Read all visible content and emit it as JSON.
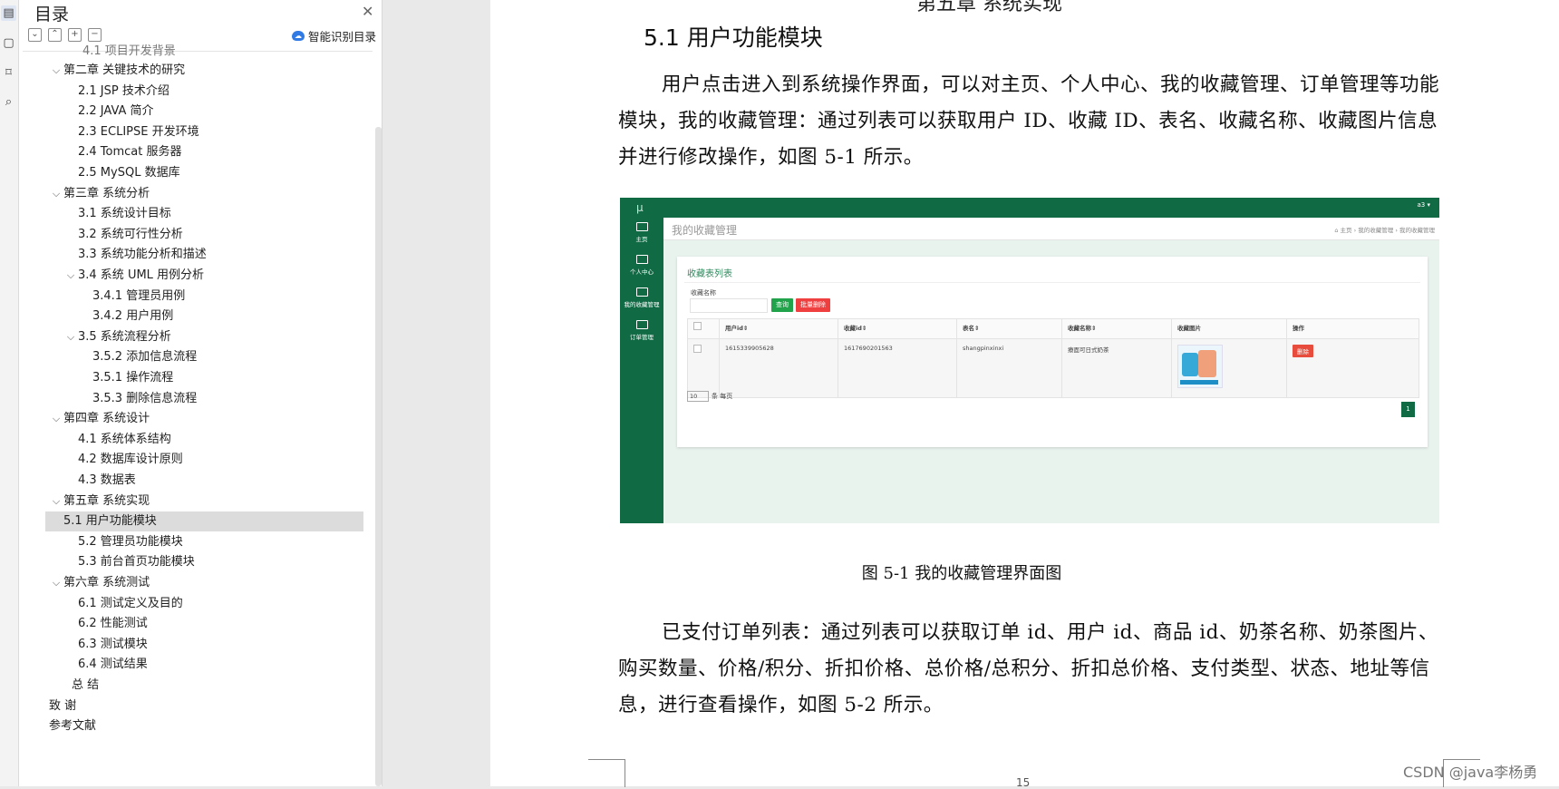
{
  "toc": {
    "title": "目录",
    "smart_label": "智能识别目录",
    "partial_top": "4.1 项目开发背景",
    "items": [
      {
        "label": "第二章 关键技术的研究",
        "level": 0,
        "chev": "⌄"
      },
      {
        "label": "2.1 JSP 技术介绍",
        "level": 1
      },
      {
        "label": "2.2 JAVA 简介",
        "level": 1
      },
      {
        "label": "2.3 ECLIPSE 开发环境",
        "level": 1
      },
      {
        "label": "2.4 Tomcat 服务器",
        "level": 1
      },
      {
        "label": "2.5 MySQL 数据库",
        "level": 1
      },
      {
        "label": "第三章  系统分析",
        "level": 0,
        "chev": "⌄"
      },
      {
        "label": "3.1  系统设计目标",
        "level": 1
      },
      {
        "label": "3.2  系统可行性分析",
        "level": 1
      },
      {
        "label": "3.3  系统功能分析和描述",
        "level": 1
      },
      {
        "label": "3.4 系统 UML 用例分析",
        "level": 1,
        "chev": "⌄"
      },
      {
        "label": "3.4.1 管理员用例",
        "level": 2
      },
      {
        "label": "3.4.2 用户用例",
        "level": 2
      },
      {
        "label": "3.5 系统流程分析",
        "level": 1,
        "chev": "⌄"
      },
      {
        "label": "3.5.2 添加信息流程",
        "level": 2
      },
      {
        "label": "3.5.1 操作流程",
        "level": 2
      },
      {
        "label": "3.5.3 删除信息流程",
        "level": 2
      },
      {
        "label": "第四章  系统设计",
        "level": 0,
        "chev": "⌄"
      },
      {
        "label": "4.1  系统体系结构",
        "level": 1
      },
      {
        "label": "4.2  数据库设计原则",
        "level": 1
      },
      {
        "label": "4.3  数据表",
        "level": 1
      },
      {
        "label": "第五章  系统实现",
        "level": 0,
        "chev": "⌄"
      },
      {
        "label": "5.1 用户功能模块",
        "level": 1,
        "selected": true
      },
      {
        "label": "5.2 管理员功能模块",
        "level": 1
      },
      {
        "label": "5.3 前台首页功能模块",
        "level": 1
      },
      {
        "label": "第六章    系统测试",
        "level": 0,
        "chev": "⌄"
      },
      {
        "label": "6.1 测试定义及目的",
        "level": 1
      },
      {
        "label": "6.2 性能测试",
        "level": 1
      },
      {
        "label": "6.3 测试模块",
        "level": 1
      },
      {
        "label": "6.4 测试结果",
        "level": 1
      },
      {
        "label": "总    结",
        "level": 0.6
      },
      {
        "label": "致    谢",
        "level": 0
      },
      {
        "label": "参考文献",
        "level": 0
      }
    ]
  },
  "doc": {
    "top_partial": "第五章   系统实现",
    "section_title": "5.1 用户功能模块",
    "para1": "用户点击进入到系统操作界面，可以对主页、个人中心、我的收藏管理、订单管理等功能模块，我的收藏管理：通过列表可以获取用户 ID、收藏 ID、表名、收藏名称、收藏图片信息并进行修改操作，如图 5-1 所示。",
    "caption": "图 5-1 我的收藏管理界面图",
    "para2": "已支付订单列表：通过列表可以获取订单 id、用户 id、商品 id、奶茶名称、奶茶图片、购买数量、价格/积分、折扣价格、总价格/总积分、折扣总价格、支付类型、状态、地址等信息，进行查看操作，如图 5-2 所示。",
    "page_num": "15",
    "watermark": "CSDN @java李杨勇"
  },
  "figure": {
    "logo": "µ",
    "user": "a3 ▾",
    "nav": [
      "主页",
      "个人中心",
      "我的收藏管理",
      "订单管理"
    ],
    "header_title": "我的收藏管理",
    "breadcrumb": "⌂ 主页  ›  我的收藏管理  ›  我的收藏管理",
    "card_title": "收藏表列表",
    "filter_label": "收藏名称",
    "btn_query": "查询",
    "btn_batch_delete": "批量删除",
    "columns": [
      "",
      "用户id⇕",
      "收藏id⇕",
      "表名⇕",
      "收藏名称⇕",
      "收藏图片",
      "操作"
    ],
    "row": {
      "user_id": "1615339905628",
      "fav_id": "1617690201563",
      "table": "shangpinxinxi",
      "name": "療面可日式奶茶",
      "action": "删除"
    },
    "per_page": "10",
    "per_page_suffix": "条 每页",
    "page": "1",
    "colors": {
      "green": "#106b45",
      "danger": "#e74c3c"
    }
  }
}
